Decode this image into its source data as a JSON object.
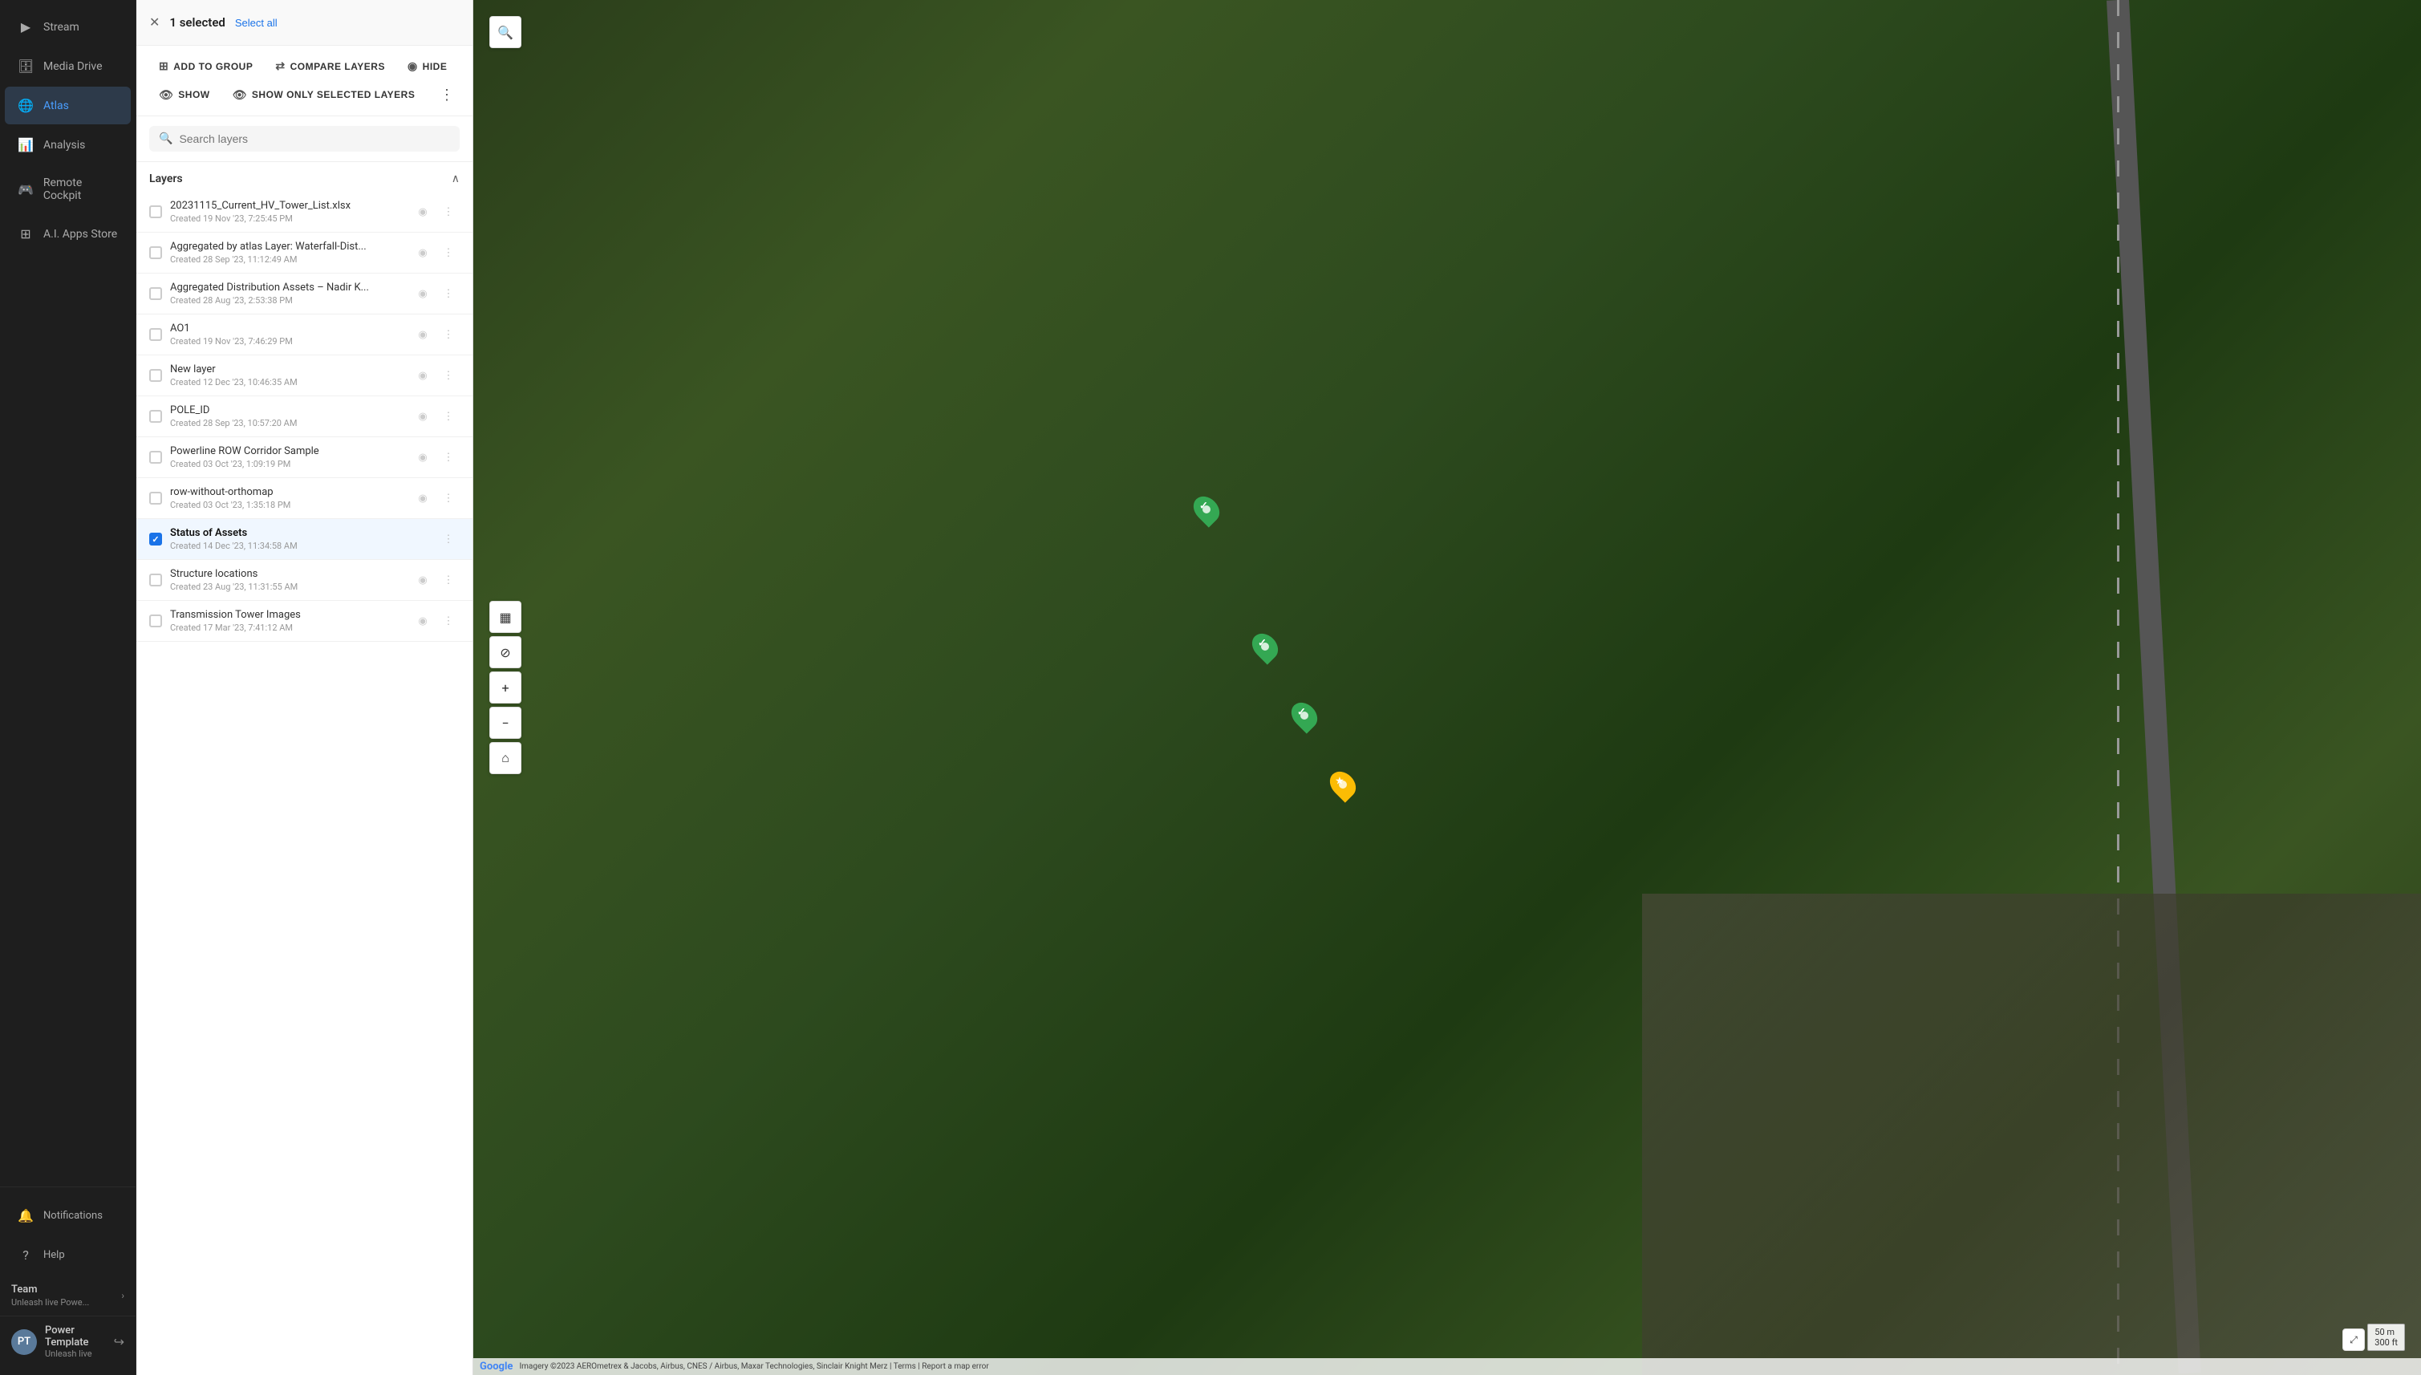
{
  "sidebar": {
    "items": [
      {
        "id": "stream",
        "label": "Stream",
        "icon": "▶",
        "active": false
      },
      {
        "id": "media-drive",
        "label": "Media Drive",
        "icon": "🗄",
        "active": false
      },
      {
        "id": "atlas",
        "label": "Atlas",
        "icon": "🌐",
        "active": true
      },
      {
        "id": "analysis",
        "label": "Analysis",
        "icon": "📊",
        "active": false
      },
      {
        "id": "remote-cockpit",
        "label": "Remote Cockpit",
        "icon": "🎮",
        "active": false
      },
      {
        "id": "ai-apps",
        "label": "A.I. Apps Store",
        "icon": "⊞",
        "active": false
      }
    ],
    "bottom_items": [
      {
        "id": "notifications",
        "label": "Notifications",
        "icon": "🔔"
      },
      {
        "id": "help",
        "label": "Help",
        "icon": "?"
      }
    ],
    "team": {
      "name": "Team",
      "sub": "Unleash live Powe..."
    },
    "user": {
      "initials": "PT",
      "name": "Power Template",
      "role": "Unleash live"
    }
  },
  "layers_panel": {
    "selected_label": "1 selected",
    "select_all_label": "Select all",
    "close_icon": "✕",
    "actions": [
      {
        "id": "add-to-group",
        "label": "ADD TO GROUP",
        "icon": "⊞"
      },
      {
        "id": "compare-layers",
        "label": "COMPARE LAYERS",
        "icon": "⇄"
      },
      {
        "id": "hide",
        "label": "HIDE",
        "icon": "👁"
      },
      {
        "id": "show",
        "label": "SHOW",
        "icon": "👁"
      },
      {
        "id": "show-only-selected",
        "label": "SHOW ONLY SELECTED LAYERS",
        "icon": "👁"
      }
    ],
    "more_btn": "⋮",
    "search": {
      "placeholder": "Search layers",
      "icon": "🔍"
    },
    "layers_title": "Layers",
    "collapse_icon": "∧",
    "layers": [
      {
        "id": "layer-1",
        "name": "20231115_Current_HV_Tower_List.xlsx",
        "date": "Created 19 Nov '23, 7:25:45 PM",
        "checked": false,
        "visible": false
      },
      {
        "id": "layer-2",
        "name": "Aggregated by atlas Layer: Waterfall-Dist...",
        "date": "Created 28 Sep '23, 11:12:49 AM",
        "checked": false,
        "visible": false
      },
      {
        "id": "layer-3",
        "name": "Aggregated Distribution Assets – Nadir K...",
        "date": "Created 28 Aug '23, 2:53:38 PM",
        "checked": false,
        "visible": false
      },
      {
        "id": "layer-4",
        "name": "AO1",
        "date": "Created 19 Nov '23, 7:46:29 PM",
        "checked": false,
        "visible": false
      },
      {
        "id": "layer-5",
        "name": "New layer",
        "date": "Created 12 Dec '23, 10:46:35 AM",
        "checked": false,
        "visible": false
      },
      {
        "id": "layer-6",
        "name": "POLE_ID",
        "date": "Created 28 Sep '23, 10:57:20 AM",
        "checked": false,
        "visible": false
      },
      {
        "id": "layer-7",
        "name": "Powerline ROW Corridor Sample",
        "date": "Created 03 Oct '23, 1:09:19 PM",
        "checked": false,
        "visible": false
      },
      {
        "id": "layer-8",
        "name": "row-without-orthomap",
        "date": "Created 03 Oct '23, 1:35:18 PM",
        "checked": false,
        "visible": false
      },
      {
        "id": "layer-9",
        "name": "Status of Assets",
        "date": "Created 14 Dec '23, 11:34:58 AM",
        "checked": true,
        "visible": true,
        "bold": true
      },
      {
        "id": "layer-10",
        "name": "Structure locations",
        "date": "Created 23 Aug '23, 11:31:55 AM",
        "checked": false,
        "visible": false
      },
      {
        "id": "layer-11",
        "name": "Transmission Tower Images",
        "date": "Created 17 Mar '23, 7:41:12 AM",
        "checked": false,
        "visible": false
      }
    ]
  },
  "map": {
    "search_icon": "🔍",
    "toolbar": [
      {
        "id": "layers-toggle",
        "icon": "▦"
      },
      {
        "id": "layers-off",
        "icon": "⊘"
      },
      {
        "id": "zoom-in",
        "icon": "+"
      },
      {
        "id": "zoom-out",
        "icon": "−"
      },
      {
        "id": "home",
        "icon": "⌂"
      }
    ],
    "markers": [
      {
        "id": "marker-1",
        "type": "green",
        "style": "top:38%;left:38%",
        "symbol": "✓"
      },
      {
        "id": "marker-2",
        "type": "green",
        "style": "top:48%;left:41%",
        "symbol": "✓"
      },
      {
        "id": "marker-3",
        "type": "green",
        "style": "top:53%;left:43%",
        "symbol": "✓"
      },
      {
        "id": "marker-4",
        "type": "yellow",
        "style": "top:58%;left:45%",
        "symbol": "★"
      }
    ],
    "scale": {
      "line1": "50 m",
      "line2": "300 ft"
    },
    "attribution": "Imagery ©2023 AEROmetrex & Jacobs, Airbus, CNES / Airbus, Maxar Technologies, Sinclair Knight Merz | Terms | Report a map error",
    "google_label": "Google"
  }
}
